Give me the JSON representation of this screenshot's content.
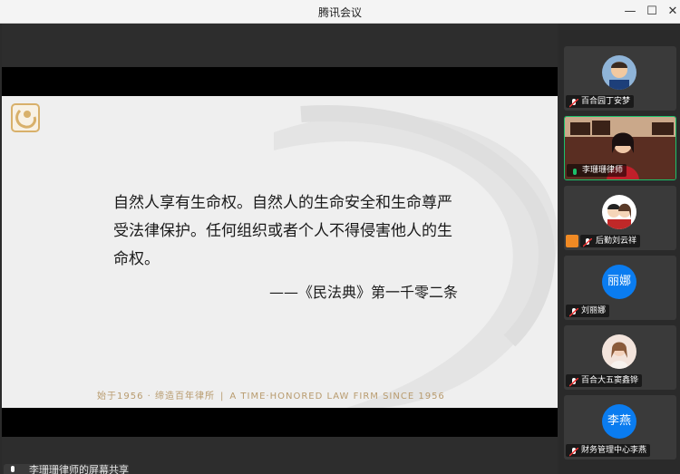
{
  "window": {
    "title": "腾讯会议",
    "minimize": "—",
    "maximize": "☐",
    "close": "✕"
  },
  "slide": {
    "quote_lines": [
      "自然人享有生命权。自然人的生命安全和生命尊严",
      "受法律保护。任何组织或者个人不得侵害他人的生",
      "命权。"
    ],
    "attribution": "——《民法典》第一千零二条",
    "tagline_cn": "始于1956 · 缔造百年律所",
    "tagline_sep": "|",
    "tagline_en": "A TIME·HONORED LAW FIRM SINCE 1956"
  },
  "speaker": {
    "label": "李珊珊律师的屏幕共享"
  },
  "participants": [
    {
      "name": "百合园丁安梦",
      "avatar": "photo-child",
      "muted": true
    },
    {
      "name": "李珊珊律师",
      "avatar": "video",
      "muted": false,
      "speaking": true
    },
    {
      "name": "后勤刘云祥",
      "avatar": "cartoon-couple",
      "muted": true,
      "hand_raised": true
    },
    {
      "name": "刘丽娜",
      "avatar_text": "丽娜",
      "muted": true
    },
    {
      "name": "百合大五窦鑫铧",
      "avatar": "photo-woman",
      "muted": true
    },
    {
      "name": "财务管理中心李燕",
      "avatar_text": "李燕",
      "muted": true
    }
  ],
  "colors": {
    "accent_green": "#1cc06b",
    "avatar_blue": "#0a7cf0",
    "gold": "#b89b6e"
  }
}
